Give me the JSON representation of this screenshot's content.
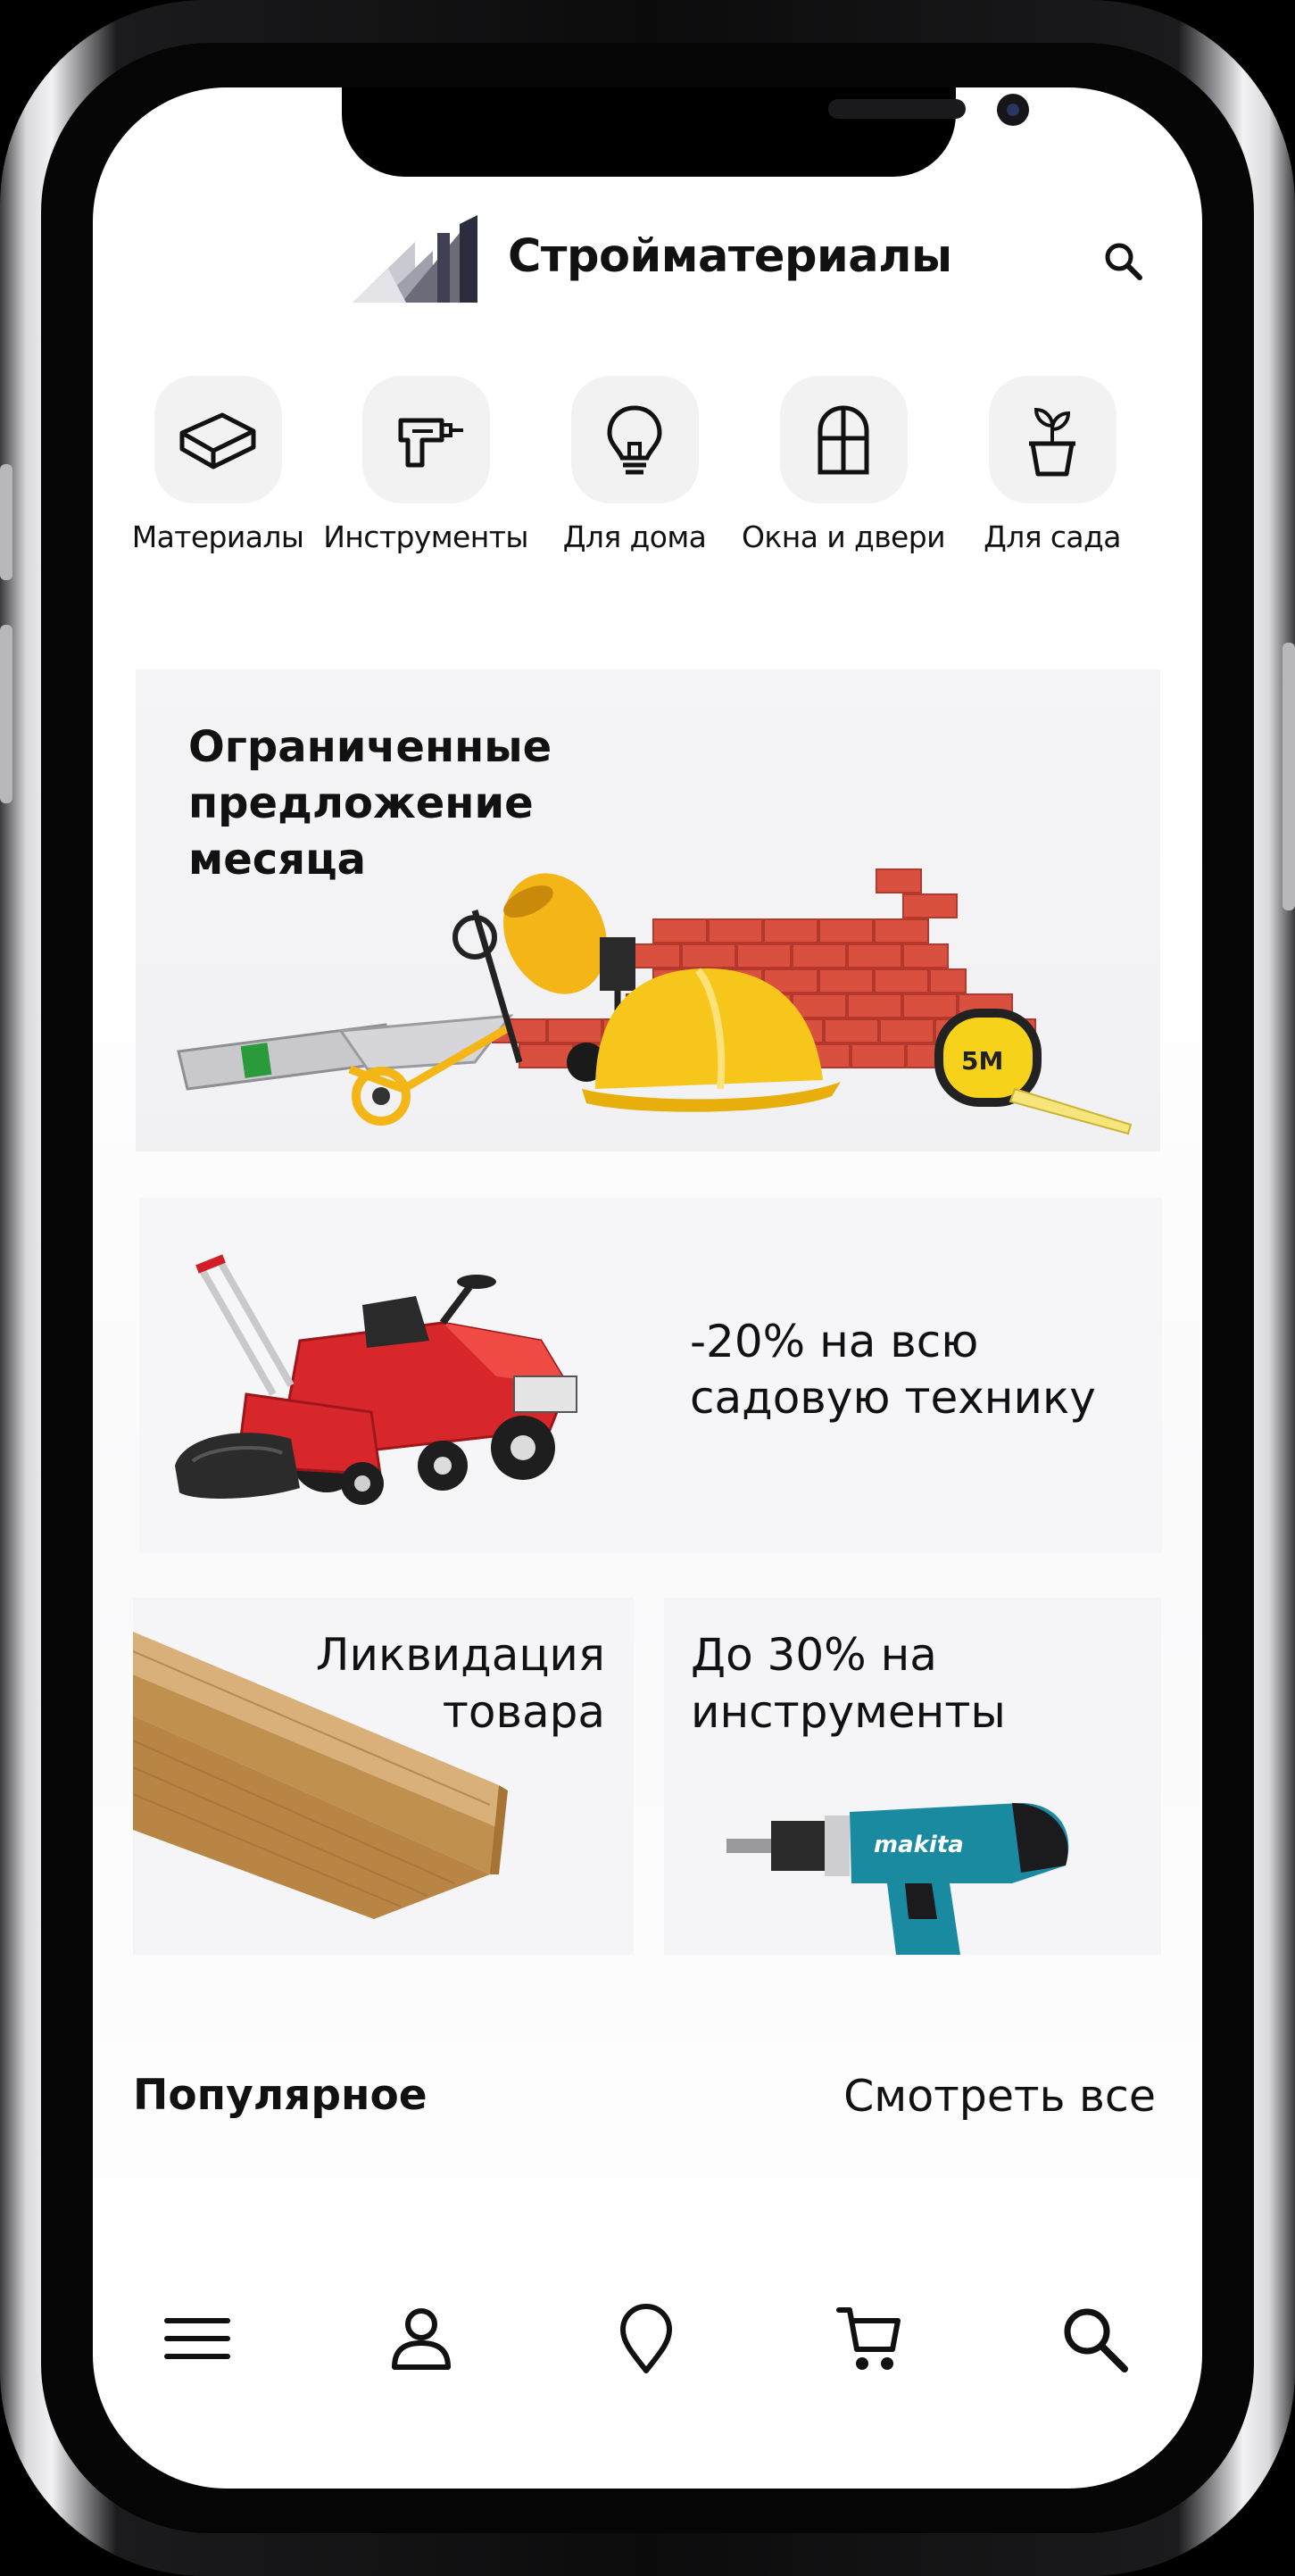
{
  "app": {
    "title": "Стройматериалы",
    "logo": "building-logo",
    "header_icon": "search-icon"
  },
  "categories": [
    {
      "label": "Материалы",
      "icon": "brick-icon"
    },
    {
      "label": "Инструменты",
      "icon": "drill-icon"
    },
    {
      "label": "Для дома",
      "icon": "lightbulb-icon"
    },
    {
      "label": "Окна и двери",
      "icon": "window-icon"
    },
    {
      "label": "Для сада",
      "icon": "plant-pot-icon"
    }
  ],
  "banners": {
    "offer": {
      "title": "Ограниченные предложение месяца"
    },
    "garden": {
      "text": "-20% на всю садовую технику"
    },
    "clearance": {
      "text": "Ликвидация товара"
    },
    "tools": {
      "text": "До 30% на инструменты",
      "brand": "makita"
    }
  },
  "popular": {
    "title": "Популярное",
    "see_all": "Смотреть все"
  },
  "bottom_nav": [
    {
      "icon": "menu-icon"
    },
    {
      "icon": "user-icon"
    },
    {
      "icon": "location-pin-icon"
    },
    {
      "icon": "cart-icon"
    },
    {
      "icon": "search-icon"
    }
  ],
  "colors": {
    "accent_red": "#e0453a",
    "helmet_yellow": "#f5c518",
    "drill_teal": "#1a8aa0",
    "text": "#111111",
    "card_bg": "#f4f4f6"
  }
}
